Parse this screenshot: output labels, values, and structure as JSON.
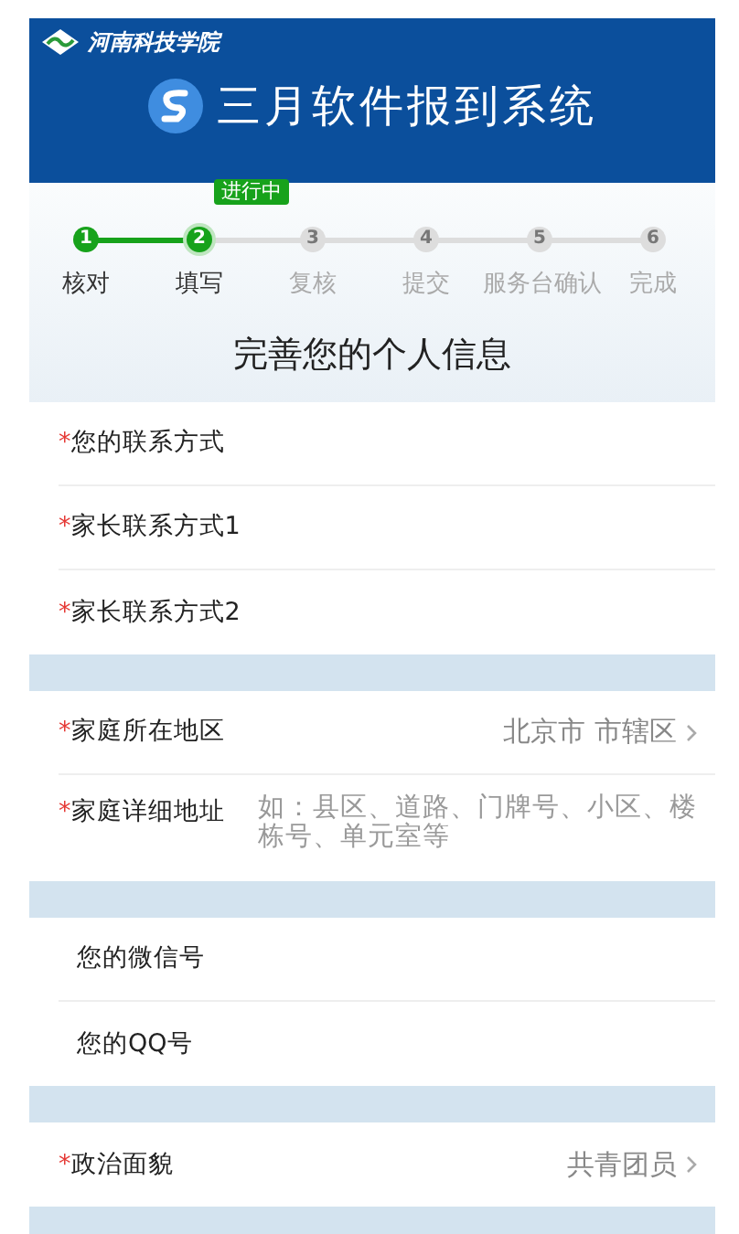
{
  "header": {
    "school": "河南科技学院",
    "title": "三月软件报到系统"
  },
  "progress": {
    "badge": "进行中",
    "steps": [
      {
        "number": "1",
        "label": "核对",
        "reached": true,
        "selected": false
      },
      {
        "number": "2",
        "label": "填写",
        "reached": true,
        "selected": true
      },
      {
        "number": "3",
        "label": "复核",
        "reached": false,
        "selected": false
      },
      {
        "number": "4",
        "label": "提交",
        "reached": false,
        "selected": false
      },
      {
        "number": "5",
        "label": "服务台确认",
        "reached": false,
        "selected": false
      },
      {
        "number": "6",
        "label": "完成",
        "reached": false,
        "selected": false
      }
    ]
  },
  "heading": "完善您的个人信息",
  "groups": [
    {
      "fields": [
        {
          "kind": "input",
          "mark": "*",
          "label": "您的联系方式"
        },
        {
          "kind": "input",
          "mark": "*",
          "label": "家长联系方式1"
        },
        {
          "kind": "input",
          "mark": "*",
          "label": "家长联系方式2"
        }
      ]
    },
    {
      "fields": [
        {
          "kind": "select",
          "mark": "*",
          "label": "家庭所在地区",
          "value": "北京市 市辖区"
        },
        {
          "kind": "textarea",
          "mark": "*",
          "label": "家庭详细地址",
          "placeholder": "如：县区、道路、门牌号、小区、楼栋号、单元室等"
        }
      ]
    },
    {
      "fields": [
        {
          "kind": "input",
          "label": "您的微信号"
        },
        {
          "kind": "input",
          "label": "您的QQ号"
        }
      ]
    },
    {
      "fields": [
        {
          "kind": "select",
          "mark": "*",
          "label": "政治面貌",
          "value": "共青团员"
        }
      ]
    }
  ]
}
